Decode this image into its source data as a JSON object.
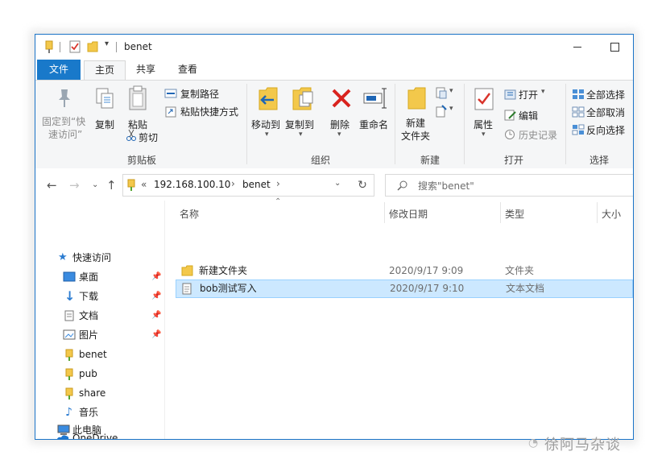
{
  "window": {
    "title": "benet"
  },
  "tabs": {
    "file": "文件",
    "home": "主页",
    "share": "共享",
    "view": "查看"
  },
  "ribbon": {
    "clipboard": {
      "label": "剪贴板",
      "pin_quick_line1": "固定到“快",
      "pin_quick_line2": "速访问”",
      "copy": "复制",
      "paste": "粘贴",
      "copy_path": "复制路径",
      "paste_shortcut": "粘贴快捷方式",
      "cut": "剪切"
    },
    "organize": {
      "label": "组织",
      "move_to": "移动到",
      "copy_to": "复制到",
      "delete": "删除",
      "rename": "重命名"
    },
    "new": {
      "label": "新建",
      "new_folder_line1": "新建",
      "new_folder_line2": "文件夹"
    },
    "open": {
      "label": "打开",
      "properties": "属性",
      "open": "打开",
      "edit": "编辑",
      "history": "历史记录"
    },
    "select": {
      "label": "选择",
      "select_all": "全部选择",
      "select_none": "全部取消",
      "invert": "反向选择"
    }
  },
  "address": {
    "prefix": "«",
    "segments": [
      "192.168.100.10",
      "benet"
    ]
  },
  "search": {
    "placeholder": "搜索\"benet\""
  },
  "nav": {
    "quick_access": "快速访问",
    "items": [
      "桌面",
      "下载",
      "文档",
      "图片",
      "benet",
      "pub",
      "share",
      "音乐"
    ],
    "onedrive": "OneDrive",
    "this_pc": "此电脑"
  },
  "columns": {
    "name": "名称",
    "modified": "修改日期",
    "type": "类型",
    "size": "大小"
  },
  "files": [
    {
      "name": "新建文件夹",
      "modified": "2020/9/17 9:09",
      "type": "文件夹"
    },
    {
      "name": "bob测试写入",
      "modified": "2020/9/17 9:10",
      "type": "文本文档"
    }
  ],
  "watermark": "徐阿马杂谈"
}
